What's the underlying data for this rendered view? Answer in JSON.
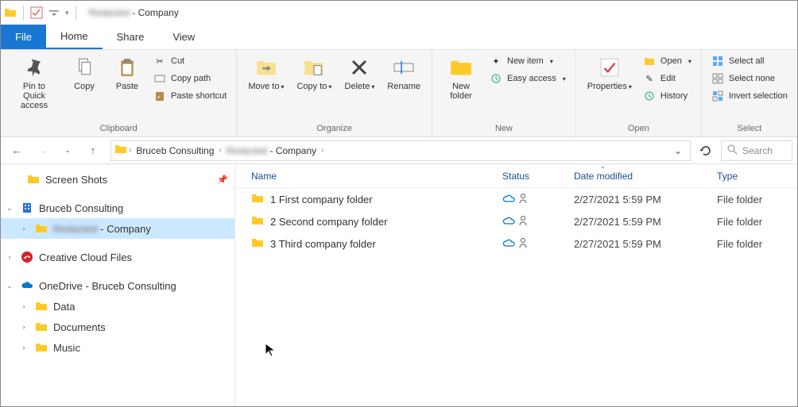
{
  "window": {
    "title_prefix": "Redacted",
    "title_suffix": " - Company"
  },
  "menu": {
    "file": "File",
    "home": "Home",
    "share": "Share",
    "view": "View"
  },
  "ribbon": {
    "clipboard": {
      "label": "Clipboard",
      "pin": "Pin to Quick access",
      "copy": "Copy",
      "paste": "Paste",
      "cut": "Cut",
      "copy_path": "Copy path",
      "paste_shortcut": "Paste shortcut"
    },
    "organize": {
      "label": "Organize",
      "move_to": "Move to",
      "copy_to": "Copy to",
      "delete": "Delete",
      "rename": "Rename"
    },
    "new": {
      "label": "New",
      "new_folder": "New folder",
      "new_item": "New item",
      "easy_access": "Easy access"
    },
    "open": {
      "label": "Open",
      "properties": "Properties",
      "open": "Open",
      "edit": "Edit",
      "history": "History"
    },
    "select": {
      "label": "Select",
      "select_all": "Select all",
      "select_none": "Select none",
      "invert": "Invert selection"
    }
  },
  "breadcrumb": {
    "root": "Bruceb Consulting",
    "mid": "Redacted",
    "leaf": " - Company"
  },
  "search": {
    "placeholder": "Search"
  },
  "tree": {
    "screen_shots": "Screen Shots",
    "bruceb": "Bruceb Consulting",
    "selected_prefix": "Redacted",
    "selected_suffix": " - Company",
    "creative_cloud": "Creative Cloud Files",
    "onedrive": "OneDrive - Bruceb Consulting",
    "data": "Data",
    "documents": "Documents",
    "music": "Music"
  },
  "columns": {
    "name": "Name",
    "status": "Status",
    "date": "Date modified",
    "type": "Type"
  },
  "files": [
    {
      "name": "1 First company folder",
      "date": "2/27/2021 5:59 PM",
      "type": "File folder"
    },
    {
      "name": "2 Second company folder",
      "date": "2/27/2021 5:59 PM",
      "type": "File folder"
    },
    {
      "name": "3 Third company folder",
      "date": "2/27/2021 5:59 PM",
      "type": "File folder"
    }
  ]
}
